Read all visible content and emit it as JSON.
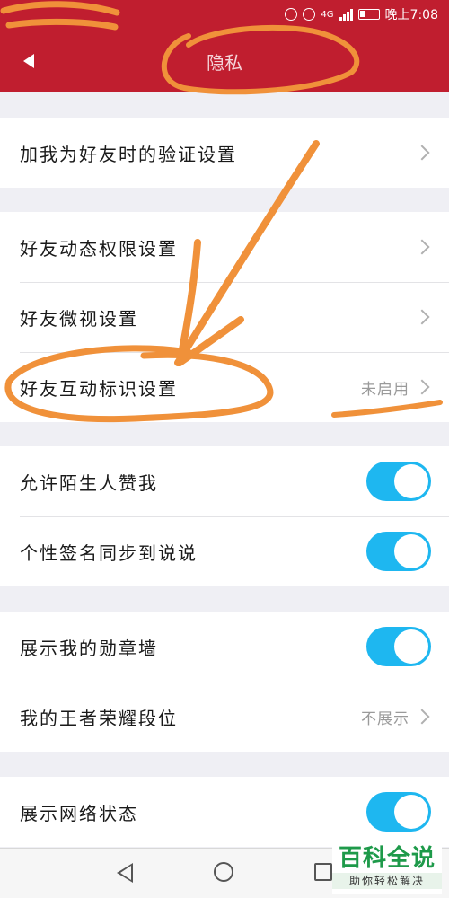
{
  "status_bar": {
    "time": "晚上7:08",
    "network": "4G"
  },
  "header": {
    "title": "隐私"
  },
  "groups": [
    {
      "rows": [
        {
          "label": "加我为好友时的验证设置",
          "type": "link"
        }
      ]
    },
    {
      "rows": [
        {
          "label": "好友动态权限设置",
          "type": "link"
        },
        {
          "label": "好友微视设置",
          "type": "link"
        },
        {
          "label": "好友互动标识设置",
          "type": "link",
          "value": "未启用"
        }
      ]
    },
    {
      "rows": [
        {
          "label": "允许陌生人赞我",
          "type": "toggle",
          "on": true
        },
        {
          "label": "个性签名同步到说说",
          "type": "toggle",
          "on": true
        }
      ]
    },
    {
      "rows": [
        {
          "label": "展示我的勋章墙",
          "type": "toggle",
          "on": true
        },
        {
          "label": "我的王者荣耀段位",
          "type": "link",
          "value": "不展示"
        }
      ]
    },
    {
      "rows": [
        {
          "label": "展示网络状态",
          "type": "toggle",
          "on": true
        }
      ]
    }
  ],
  "watermark": {
    "title": "百科全说",
    "subtitle": "助你轻松解决"
  },
  "colors": {
    "header_bg": "#c01e2f",
    "toggle_on": "#1eb7f0",
    "annotation": "#f0913a",
    "watermark_green": "#1e9a4a"
  }
}
